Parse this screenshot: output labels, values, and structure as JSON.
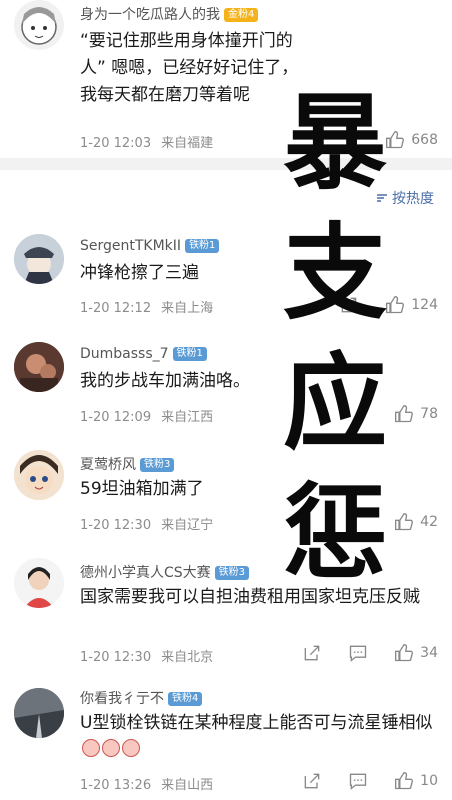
{
  "comments": [
    {
      "username": "身为一个吃瓜路人的我",
      "badge": "金粉4",
      "text": "“要记住那些用身体撞开门的人” 嗯嗯，已经好好记住了，我每天都在磨刀等着呢",
      "time": "1-20 12:03",
      "location": "来自福建",
      "likes": "668"
    },
    {
      "username": "SergentTKMkII",
      "badge": "铁粉1",
      "text": "冲锋枪擦了三遍",
      "time": "1-20 12:12",
      "location": "来自上海",
      "likes": "124"
    },
    {
      "username": "Dumbasss_7",
      "badge": "铁粉1",
      "text": "我的步战车加满油咯。",
      "time": "1-20 12:09",
      "location": "来自江西",
      "likes": "78"
    },
    {
      "username": "夏莺桥风",
      "badge": "铁粉3",
      "text": "59坦油箱加满了",
      "time": "1-20 12:30",
      "location": "来自辽宁",
      "likes": "42"
    },
    {
      "username": "德州小学真人CS大赛",
      "badge": "铁粉3",
      "text": "国家需要我可以自担油费租用国家坦克压反贼",
      "time": "1-20 12:30",
      "location": "来自北京",
      "likes": "34"
    },
    {
      "username": "你看我彳亍不",
      "badge": "铁粉4",
      "text": "U型锁栓铁链在某种程度上能否可与流星锤相似",
      "time": "1-20 13:26",
      "location": "来自山西",
      "likes": "10"
    }
  ],
  "sort_label": "按热度",
  "overlay_chars": [
    "暴",
    "支",
    "应",
    "惩"
  ],
  "colors": {
    "badge_gold": "#f4b21b",
    "badge_iron": "#5b9bd5",
    "link": "#4a6ea8"
  }
}
